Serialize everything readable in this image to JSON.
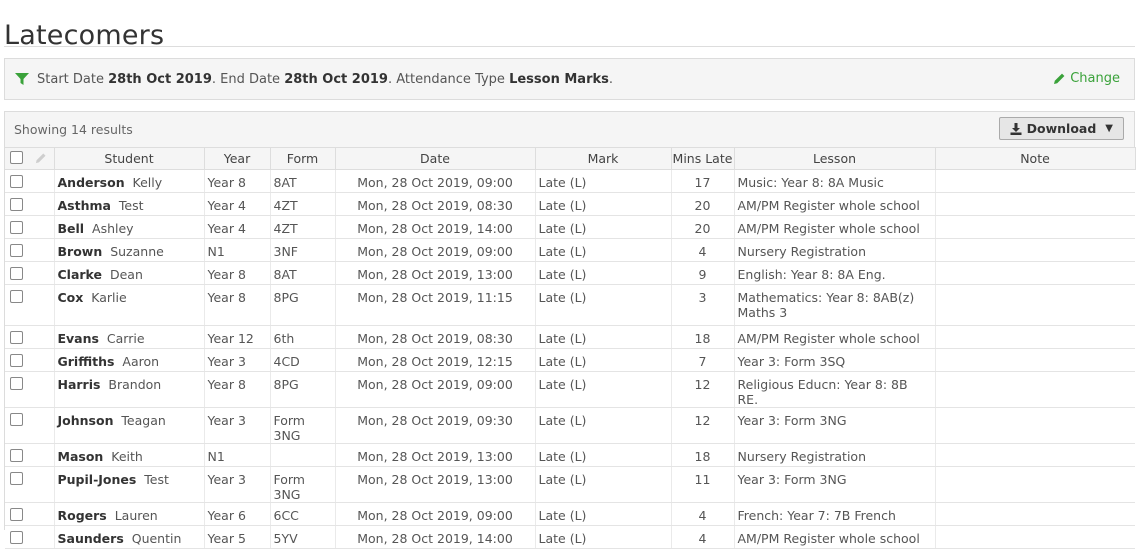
{
  "page": {
    "title": "Latecomers"
  },
  "filter": {
    "start_label": "Start Date",
    "start_value": "28th Oct 2019",
    "end_label": ". End Date",
    "end_value": "28th Oct 2019",
    "type_label": ". Attendance Type",
    "type_value": "Lesson Marks",
    "period": ".",
    "change_label": "Change"
  },
  "results": {
    "count_text": "Showing 14 results",
    "download_label": "Download"
  },
  "table": {
    "columns": [
      "Student",
      "Year",
      "Form",
      "Date",
      "Mark",
      "Mins Late",
      "Lesson",
      "Note"
    ],
    "rows": [
      {
        "surname": "Anderson",
        "forename": "Kelly",
        "year": "Year 8",
        "form": "8AT",
        "date": "Mon, 28 Oct 2019, 09:00",
        "mark": "Late (L)",
        "mins": "17",
        "lesson": "Music: Year 8: 8A Music",
        "note": ""
      },
      {
        "surname": "Asthma",
        "forename": "Test",
        "year": "Year 4",
        "form": "4ZT",
        "date": "Mon, 28 Oct 2019, 08:30",
        "mark": "Late (L)",
        "mins": "20",
        "lesson": "AM/PM Register whole school",
        "note": ""
      },
      {
        "surname": "Bell",
        "forename": "Ashley",
        "year": "Year 4",
        "form": "4ZT",
        "date": "Mon, 28 Oct 2019, 14:00",
        "mark": "Late (L)",
        "mins": "20",
        "lesson": "AM/PM Register whole school",
        "note": ""
      },
      {
        "surname": "Brown",
        "forename": "Suzanne",
        "year": "N1",
        "form": "3NF",
        "date": "Mon, 28 Oct 2019, 09:00",
        "mark": "Late (L)",
        "mins": "4",
        "lesson": "Nursery Registration",
        "note": ""
      },
      {
        "surname": "Clarke",
        "forename": "Dean",
        "year": "Year 8",
        "form": "8AT",
        "date": "Mon, 28 Oct 2019, 13:00",
        "mark": "Late (L)",
        "mins": "9",
        "lesson": "English: Year 8: 8A Eng.",
        "note": ""
      },
      {
        "surname": "Cox",
        "forename": "Karlie",
        "year": "Year 8",
        "form": "8PG",
        "date": "Mon, 28 Oct 2019, 11:15",
        "mark": "Late (L)",
        "mins": "3",
        "lesson": "Mathematics: Year 8: 8AB(z) Maths 3",
        "note": ""
      },
      {
        "surname": "Evans",
        "forename": "Carrie",
        "year": "Year 12",
        "form": "6th",
        "date": "Mon, 28 Oct 2019, 08:30",
        "mark": "Late (L)",
        "mins": "18",
        "lesson": "AM/PM Register whole school",
        "note": ""
      },
      {
        "surname": "Griffiths",
        "forename": "Aaron",
        "year": "Year 3",
        "form": "4CD",
        "date": "Mon, 28 Oct 2019, 12:15",
        "mark": "Late (L)",
        "mins": "7",
        "lesson": "Year 3: Form 3SQ",
        "note": ""
      },
      {
        "surname": "Harris",
        "forename": "Brandon",
        "year": "Year 8",
        "form": "8PG",
        "date": "Mon, 28 Oct 2019, 09:00",
        "mark": "Late (L)",
        "mins": "12",
        "lesson": "Religious Educn: Year 8: 8B RE.",
        "note": ""
      },
      {
        "surname": "Johnson",
        "forename": "Teagan",
        "year": "Year 3",
        "form": "Form 3NG",
        "date": "Mon, 28 Oct 2019, 09:30",
        "mark": "Late (L)",
        "mins": "12",
        "lesson": "Year 3: Form 3NG",
        "note": ""
      },
      {
        "surname": "Mason",
        "forename": "Keith",
        "year": "N1",
        "form": "",
        "date": "Mon, 28 Oct 2019, 13:00",
        "mark": "Late (L)",
        "mins": "18",
        "lesson": "Nursery Registration",
        "note": ""
      },
      {
        "surname": "Pupil-Jones",
        "forename": "Test",
        "year": "Year 3",
        "form": "Form 3NG",
        "date": "Mon, 28 Oct 2019, 13:00",
        "mark": "Late (L)",
        "mins": "11",
        "lesson": "Year 3: Form 3NG",
        "note": ""
      },
      {
        "surname": "Rogers",
        "forename": "Lauren",
        "year": "Year 6",
        "form": "6CC",
        "date": "Mon, 28 Oct 2019, 09:00",
        "mark": "Late (L)",
        "mins": "4",
        "lesson": "French: Year 7: 7B French",
        "note": ""
      },
      {
        "surname": "Saunders",
        "forename": "Quentin",
        "year": "Year 5",
        "form": "5YV",
        "date": "Mon, 28 Oct 2019, 14:00",
        "mark": "Late (L)",
        "mins": "4",
        "lesson": "AM/PM Register whole school",
        "note": ""
      }
    ]
  },
  "colors": {
    "accent_green": "#3aa23a"
  }
}
